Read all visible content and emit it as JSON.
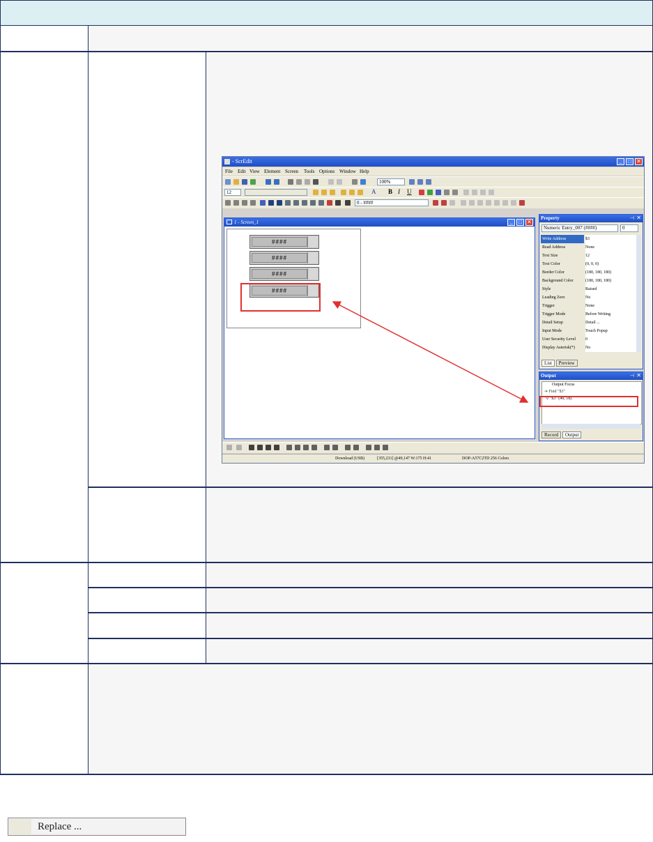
{
  "shot": {
    "window_title": "- ScrEdit",
    "menus": [
      "File",
      "Edit",
      "View",
      "Element",
      "Screen",
      "Tools",
      "Options",
      "Window",
      "Help"
    ],
    "zoom": "100%",
    "font_size": "12",
    "element_combo": "0 - ####",
    "screen_title": "1 - Screen_1",
    "entries": [
      "####",
      "####",
      "####",
      "####"
    ],
    "property": {
      "title": "Property",
      "selector": "Numeric Entry_007 (####)",
      "selector_num": "0",
      "rows": [
        {
          "k": "Write Address",
          "v": "$3"
        },
        {
          "k": "Read Address",
          "v": "None"
        },
        {
          "k": "Text Size",
          "v": "12"
        },
        {
          "k": "Text Color",
          "v": "(0, 0, 0)"
        },
        {
          "k": "Border Color",
          "v": "(180, 180, 180)"
        },
        {
          "k": "Background Color",
          "v": "(180, 180, 180)"
        },
        {
          "k": "Style",
          "v": "Raised"
        },
        {
          "k": "Leading Zero",
          "v": "No"
        },
        {
          "k": "Trigger",
          "v": "None"
        },
        {
          "k": "Trigger Mode",
          "v": "Before Writing"
        },
        {
          "k": "Detail Setup",
          "v": "Detail ..."
        },
        {
          "k": "Input Mode",
          "v": "Touch Popup"
        },
        {
          "k": "User Security Level",
          "v": "0"
        },
        {
          "k": "Display Asterisk(*)",
          "v": "No"
        }
      ],
      "tabs": [
        "List",
        "Preview"
      ]
    },
    "output": {
      "title": "Output",
      "focus": "Output Focus",
      "find": "Find \"$3\"",
      "result": "\"$3\" (49, 18)",
      "tabs": [
        "Record",
        "Output"
      ]
    },
    "status": {
      "download": "Download (USB)",
      "coords": "[355,231] @49,147 W:175 H:41",
      "model": "DOP-A57C2TD 256 Colors"
    },
    "colors": {
      "header_bg": "#dcf0f3",
      "border": "#1f2f5e",
      "highlight": "#e03030",
      "title_bar": "#2a5bd6"
    }
  },
  "bottom_button": {
    "label": "Replace ..."
  }
}
